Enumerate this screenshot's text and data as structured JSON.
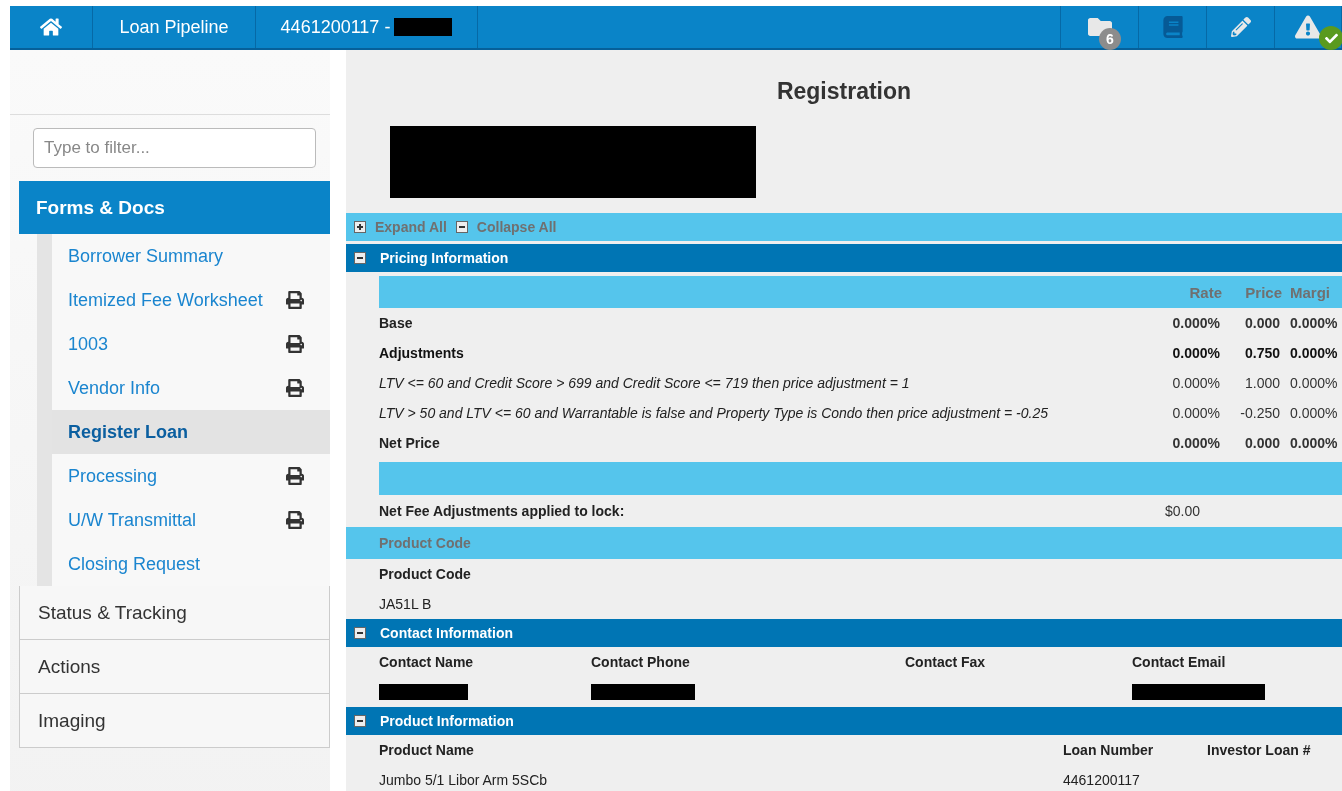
{
  "topbar": {
    "nav": [
      {
        "kind": "home"
      },
      {
        "kind": "text",
        "label": "Loan Pipeline"
      },
      {
        "kind": "loan",
        "label": "4461200117 -",
        "redacted": true
      }
    ],
    "tools": [
      {
        "kind": "folder",
        "badge": "6"
      },
      {
        "kind": "book"
      },
      {
        "kind": "pencil"
      },
      {
        "kind": "alert",
        "checked": true
      }
    ]
  },
  "sidebar": {
    "filter": {
      "placeholder": "Type to filter..."
    },
    "sections": [
      {
        "label": "Forms & Docs",
        "expanded": true,
        "items": [
          {
            "label": "Borrower Summary",
            "printable": false,
            "selected": false
          },
          {
            "label": "Itemized Fee Worksheet",
            "printable": true,
            "selected": false
          },
          {
            "label": "1003",
            "printable": true,
            "selected": false
          },
          {
            "label": "Vendor Info",
            "printable": true,
            "selected": false
          },
          {
            "label": "Register Loan",
            "printable": false,
            "selected": true
          },
          {
            "label": "Processing",
            "printable": true,
            "selected": false
          },
          {
            "label": "U/W Transmittal",
            "printable": true,
            "selected": false
          },
          {
            "label": "Closing Request",
            "printable": false,
            "selected": false
          }
        ]
      },
      {
        "label": "Status & Tracking",
        "expanded": false
      },
      {
        "label": "Actions",
        "expanded": false
      },
      {
        "label": "Imaging",
        "expanded": false
      }
    ]
  },
  "main": {
    "title": "Registration",
    "redacted_header": true,
    "toolbar": {
      "expand": "Expand All",
      "collapse": "Collapse All"
    },
    "pricing": {
      "title": "Pricing Information",
      "expanded": true,
      "columns": [
        "Rate",
        "Price",
        "Margi"
      ],
      "rows": [
        {
          "kind": "bold",
          "label": "Base",
          "values": [
            "0.000%",
            "0.000",
            "0.000%"
          ]
        },
        {
          "kind": "strong",
          "label": "Adjustments",
          "values": [
            "0.000%",
            "0.750",
            "0.000%"
          ]
        },
        {
          "kind": "italic",
          "label": "LTV <= 60 and Credit Score > 699 and Credit Score <= 719 then price adjustment = 1",
          "values": [
            "0.000%",
            "1.000",
            "0.000%"
          ]
        },
        {
          "kind": "italic",
          "label": "LTV > 50 and LTV <= 60 and Warrantable is false and Property Type is Condo then price adjustment = -0.25",
          "values": [
            "0.000%",
            "-0.250",
            "0.000%"
          ]
        },
        {
          "kind": "bold",
          "label": "Net Price",
          "values": [
            "0.000%",
            "0.000",
            "0.000%"
          ]
        }
      ],
      "fee_label": "Net Fee Adjustments applied to lock:",
      "fee_value": "$0.00"
    },
    "product_code": {
      "title": "Product Code",
      "label": "Product Code",
      "value": "JA51L B"
    },
    "contact": {
      "title": "Contact Information",
      "expanded": true,
      "columns": [
        {
          "label": "Contact Name",
          "redacted": true
        },
        {
          "label": "Contact Phone",
          "redacted": true
        },
        {
          "label": "Contact Fax",
          "redacted": false
        },
        {
          "label": "Contact Email",
          "redacted": true
        }
      ]
    },
    "product": {
      "title": "Product Information",
      "expanded": true,
      "columns": [
        {
          "label": "Product Name",
          "value": "Jumbo 5/1 Libor Arm 5SCb"
        },
        {
          "label": "Loan Number",
          "value": "4461200117"
        },
        {
          "label": "Investor Loan #"
        }
      ]
    }
  }
}
